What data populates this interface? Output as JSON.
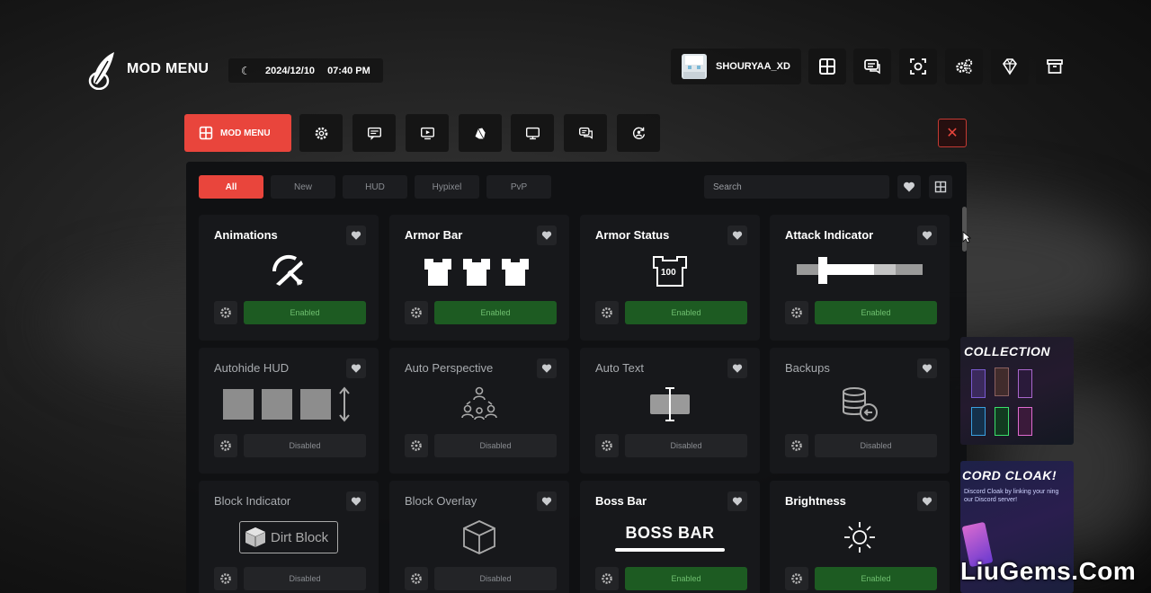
{
  "header": {
    "brand": "MOD MENU",
    "date": "2024/12/10",
    "time": "07:40 PM",
    "username": "SHOURYAA_XD",
    "icons": [
      "grid-icon",
      "chat-icon",
      "screenshot-icon",
      "settings-icon",
      "diamond-icon",
      "archive-icon"
    ]
  },
  "tabs": {
    "active_label": "MOD MENU",
    "icons": [
      "gear-icon",
      "message-icon",
      "monitor-play-icon",
      "cosmetics-icon",
      "display-icon",
      "chat-bubbles-icon",
      "profile-refresh-icon"
    ]
  },
  "filters": [
    "All",
    "New",
    "HUD",
    "Hypixel",
    "PvP"
  ],
  "search": {
    "placeholder": "Search"
  },
  "mods": [
    {
      "title": "Animations",
      "status": "Enabled",
      "enabled": true,
      "art": "animations"
    },
    {
      "title": "Armor Bar",
      "status": "Enabled",
      "enabled": true,
      "art": "armor-bar"
    },
    {
      "title": "Armor Status",
      "status": "Enabled",
      "enabled": true,
      "art": "armor-status",
      "art_text": "100"
    },
    {
      "title": "Attack Indicator",
      "status": "Enabled",
      "enabled": true,
      "art": "attack-indicator"
    },
    {
      "title": "Autohide HUD",
      "status": "Disabled",
      "enabled": false,
      "art": "autohide"
    },
    {
      "title": "Auto Perspective",
      "status": "Disabled",
      "enabled": false,
      "art": "perspective"
    },
    {
      "title": "Auto Text",
      "status": "Disabled",
      "enabled": false,
      "art": "autotext"
    },
    {
      "title": "Backups",
      "status": "Disabled",
      "enabled": false,
      "art": "backups"
    },
    {
      "title": "Block Indicator",
      "status": "Disabled",
      "enabled": false,
      "art": "block-indicator",
      "art_text": "Dirt Block"
    },
    {
      "title": "Block Overlay",
      "status": "Disabled",
      "enabled": false,
      "art": "block-overlay"
    },
    {
      "title": "Boss Bar",
      "status": "Enabled",
      "enabled": true,
      "art": "boss-bar",
      "art_text": "BOSS BAR"
    },
    {
      "title": "Brightness",
      "status": "Enabled",
      "enabled": true,
      "art": "brightness"
    }
  ],
  "ads": [
    {
      "title": "COLLECTION",
      "text": ""
    },
    {
      "title": "CORD CLOAK!",
      "text": "Discord Cloak by linking your ning our Discord server!"
    }
  ],
  "watermark": "LiuGems.Com",
  "colors": {
    "accent": "#e9453c",
    "enabled": "#1d5b22",
    "enabled_text": "#6fbf6f"
  }
}
